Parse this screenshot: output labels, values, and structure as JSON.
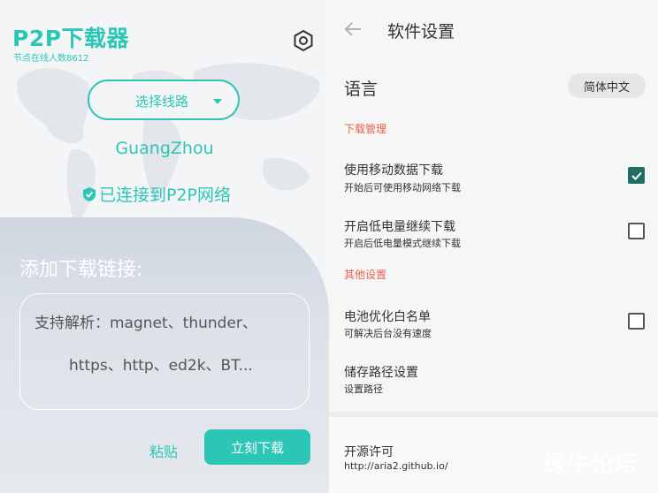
{
  "downloader": {
    "app_title": "P2P下载器",
    "nodes_online": "节点在线人数8612",
    "settings_icon": "hexagon-settings-icon",
    "route_select_label": "选择线路",
    "city": "GuangZhou",
    "connection_status": "已连接到P2P网络",
    "add_link_title": "添加下载链接:",
    "link_placeholder_line1": "支持解析：magnet、thunder、",
    "link_placeholder_line2": "https、http、ed2k、BT...",
    "paste_label": "粘贴",
    "download_now_label": "立刻下载",
    "accent_color": "#2cc6b6"
  },
  "settings": {
    "page_title": "软件设置",
    "language": {
      "label": "语言",
      "value": "简体中文"
    },
    "sections": {
      "download": "下载管理",
      "other": "其他设置"
    },
    "items": [
      {
        "title": "使用移动数据下载",
        "subtitle": "开始后可使用移动网络下载",
        "checked": true
      },
      {
        "title": "开启低电量继续下载",
        "subtitle": "开启后低电量模式继续下载",
        "checked": false
      },
      {
        "title": "电池优化白名单",
        "subtitle": "可解决后台没有速度",
        "checked": false
      },
      {
        "title": "储存路径设置",
        "subtitle": "设置路径"
      }
    ],
    "license": {
      "title": "开源许可",
      "url": "http://aria2.github.io/"
    },
    "section_color": "#e8624e",
    "checkbox_checked_color": "#1f6f66"
  },
  "watermark": "绿牛论坛"
}
